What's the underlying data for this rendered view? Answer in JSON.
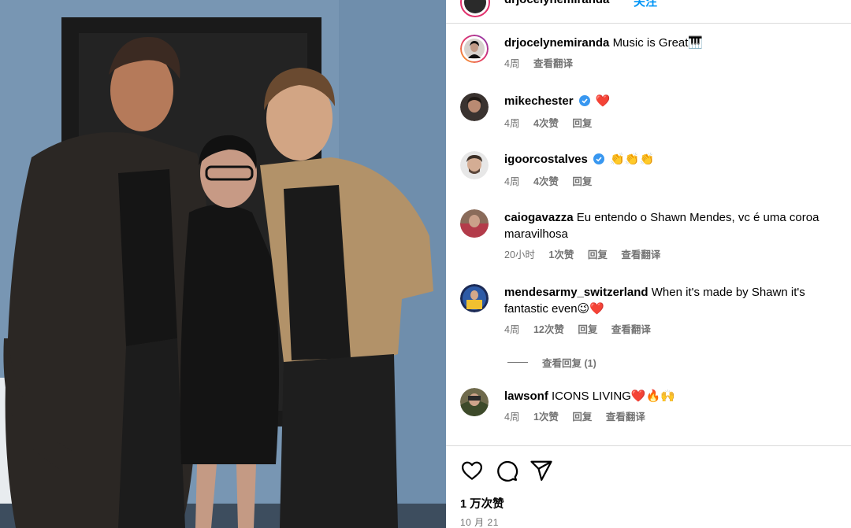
{
  "post": {
    "author": "drjocelynemiranda",
    "follow_label": "关注",
    "likes": "1 万次赞",
    "date": "10 月 21"
  },
  "comments": [
    {
      "user": "drjocelynemiranda",
      "text": "Music is Great🎹",
      "meta": [
        "4周",
        "查看翻译"
      ],
      "verified": false
    },
    {
      "user": "mikechester",
      "text": "❤️",
      "meta": [
        "4周",
        "4次赞",
        "回复"
      ],
      "verified": true
    },
    {
      "user": "igoorcostalves",
      "text": "👏👏👏",
      "meta": [
        "4周",
        "4次赞",
        "回复"
      ],
      "verified": true
    },
    {
      "user": "caiogavazza",
      "text": "Eu entendo o Shawn Mendes, vc é uma coroa maravilhosa",
      "meta": [
        "20小时",
        "1次赞",
        "回复",
        "查看翻译"
      ],
      "verified": false
    },
    {
      "user": "mendesarmy_switzerland",
      "text": "When it's made by Shawn it's fantastic even😉❤️",
      "meta": [
        "4周",
        "12次赞",
        "回复",
        "查看翻译"
      ],
      "verified": false
    },
    {
      "user": "lawsonf",
      "text": "ICONS LIVING❤️🔥🙌",
      "meta": [
        "4周",
        "1次赞",
        "回复",
        "查看翻译"
      ],
      "verified": false
    }
  ],
  "view_replies": "查看回复 (1)",
  "icons": [
    "heart-icon",
    "comment-icon",
    "share-icon",
    "verified-icon"
  ],
  "colors": {
    "link": "#0095f6",
    "muted": "#737373",
    "divider": "#dbdbdb",
    "verified": "#3897f0"
  }
}
